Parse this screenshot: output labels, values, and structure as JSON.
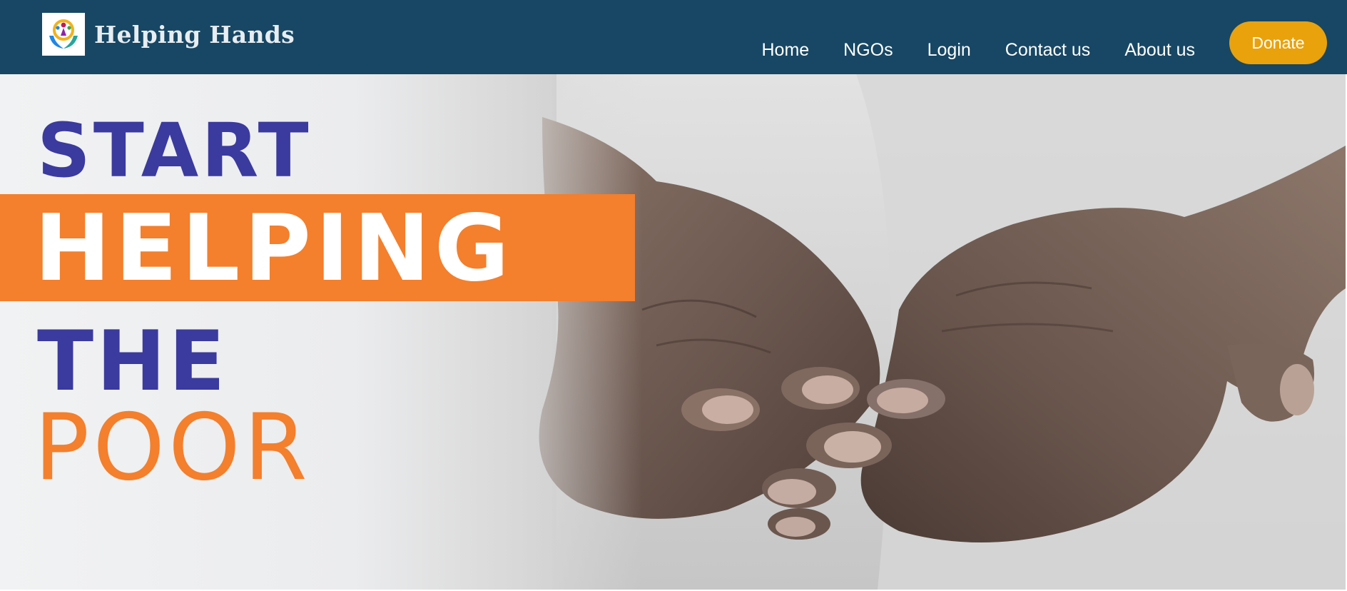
{
  "brand": {
    "name": "Helping Hands",
    "logo_icon": "helping-hands-logo"
  },
  "nav": {
    "items": [
      {
        "label": "Home"
      },
      {
        "label": "NGOs"
      },
      {
        "label": "Login"
      },
      {
        "label": "Contact us"
      },
      {
        "label": "About us"
      }
    ],
    "donate_label": "Donate"
  },
  "hero": {
    "line1": "START",
    "line2": "HELPING",
    "line3": "THE",
    "line4": "POOR",
    "image_subject": "cupped-hands-photo"
  },
  "colors": {
    "navbar": "#174764",
    "donate": "#e9a20c",
    "accent_orange": "#f47f2c",
    "accent_indigo": "#3b3a9e"
  }
}
